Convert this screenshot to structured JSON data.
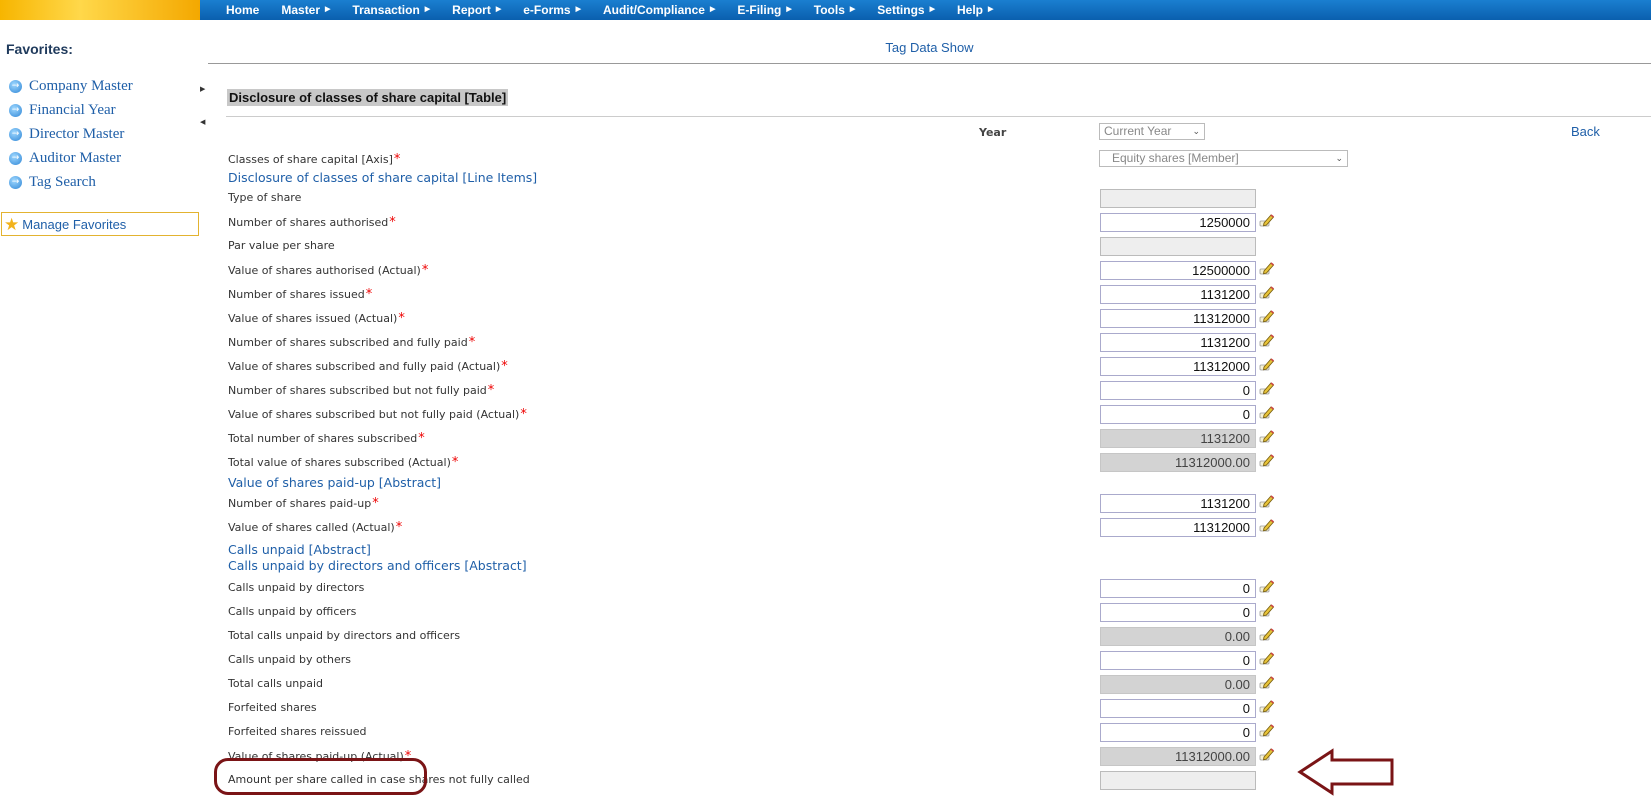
{
  "nav": {
    "items": [
      {
        "label": "Home",
        "has_menu": false
      },
      {
        "label": "Master",
        "has_menu": true
      },
      {
        "label": "Transaction",
        "has_menu": true
      },
      {
        "label": "Report",
        "has_menu": true
      },
      {
        "label": "e-Forms",
        "has_menu": true
      },
      {
        "label": "Audit/Compliance",
        "has_menu": true
      },
      {
        "label": "E-Filing",
        "has_menu": true
      },
      {
        "label": "Tools",
        "has_menu": true
      },
      {
        "label": "Settings",
        "has_menu": true
      },
      {
        "label": "Help",
        "has_menu": true
      }
    ]
  },
  "sidebar": {
    "title": "Favorites:",
    "items": [
      "Company Master",
      "Financial Year",
      "Director Master",
      "Auditor Master",
      "Tag Search"
    ],
    "manage_label": "Manage Favorites"
  },
  "header": {
    "title": "Tag Data Show"
  },
  "section": {
    "title": "Disclosure of classes of share capital [Table]"
  },
  "year": {
    "label": "Year",
    "selected": "Current Year"
  },
  "back_label": "Back",
  "axis": {
    "label": "Classes of share capital [Axis]",
    "selected": "Equity shares [Member]"
  },
  "rows": [
    {
      "type": "heading",
      "label": "Disclosure of classes of share capital [Line Items]"
    },
    {
      "type": "field",
      "label": "Type of share",
      "required": false,
      "value": "",
      "state": "empty",
      "edit": false
    },
    {
      "type": "field",
      "label": "Number of shares authorised",
      "required": true,
      "value": "1250000",
      "state": "editable",
      "edit": true
    },
    {
      "type": "field",
      "label": "Par value per share",
      "required": false,
      "value": "",
      "state": "empty",
      "edit": false
    },
    {
      "type": "field",
      "label": "Value of shares authorised (Actual)",
      "required": true,
      "value": "12500000",
      "state": "editable",
      "edit": true
    },
    {
      "type": "field",
      "label": "Number of shares issued",
      "required": true,
      "value": "1131200",
      "state": "editable",
      "edit": true
    },
    {
      "type": "field",
      "label": "Value of shares issued (Actual)",
      "required": true,
      "value": "11312000",
      "state": "editable",
      "edit": true
    },
    {
      "type": "field",
      "label": "Number of shares subscribed and fully paid",
      "required": true,
      "value": "1131200",
      "state": "editable",
      "edit": true
    },
    {
      "type": "field",
      "label": "Value of shares subscribed and fully paid (Actual)",
      "required": true,
      "value": "11312000",
      "state": "editable",
      "edit": true
    },
    {
      "type": "field",
      "label": "Number of shares subscribed but not fully paid",
      "required": true,
      "value": "0",
      "state": "editable",
      "edit": true
    },
    {
      "type": "field",
      "label": "Value of shares subscribed but not fully paid (Actual)",
      "required": true,
      "value": "0",
      "state": "editable",
      "edit": true
    },
    {
      "type": "field",
      "label": "Total number of shares subscribed",
      "required": true,
      "value": "1131200",
      "state": "readonly",
      "edit": true
    },
    {
      "type": "field",
      "label": "Total value of shares subscribed (Actual)",
      "required": true,
      "value": "11312000.00",
      "state": "readonly",
      "edit": true
    },
    {
      "type": "heading",
      "label": "Value of shares paid-up [Abstract]"
    },
    {
      "type": "field",
      "label": "Number of shares paid-up",
      "required": true,
      "value": "1131200",
      "state": "editable",
      "edit": true
    },
    {
      "type": "field",
      "label": "Value of shares called (Actual)",
      "required": true,
      "value": "11312000",
      "state": "editable",
      "edit": true
    },
    {
      "type": "heading",
      "label": "Calls unpaid [Abstract]"
    },
    {
      "type": "heading",
      "label": "Calls unpaid by directors and officers [Abstract]"
    },
    {
      "type": "field",
      "label": "Calls unpaid by directors",
      "required": false,
      "value": "0",
      "state": "editable",
      "edit": true
    },
    {
      "type": "field",
      "label": "Calls unpaid by officers",
      "required": false,
      "value": "0",
      "state": "editable",
      "edit": true
    },
    {
      "type": "field",
      "label": "Total calls unpaid by directors and officers",
      "required": false,
      "value": "0.00",
      "state": "readonly",
      "edit": true
    },
    {
      "type": "field",
      "label": "Calls unpaid by others",
      "required": false,
      "value": "0",
      "state": "editable",
      "edit": true
    },
    {
      "type": "field",
      "label": "Total calls unpaid",
      "required": false,
      "value": "0.00",
      "state": "readonly",
      "edit": true
    },
    {
      "type": "field",
      "label": "Forfeited shares",
      "required": false,
      "value": "0",
      "state": "editable",
      "edit": true
    },
    {
      "type": "field",
      "label": "Forfeited shares reissued",
      "required": false,
      "value": "0",
      "state": "editable",
      "edit": true
    },
    {
      "type": "field",
      "label": "Value of shares paid-up (Actual)",
      "required": true,
      "value": "11312000.00",
      "state": "readonly",
      "edit": true
    },
    {
      "type": "field",
      "label": "Amount per share called in case shares not fully called",
      "required": false,
      "value": "",
      "state": "empty",
      "edit": false
    }
  ],
  "colors": {
    "accent": "#1f5fa8",
    "annotation": "#7a1416",
    "required": "#ee0000"
  }
}
